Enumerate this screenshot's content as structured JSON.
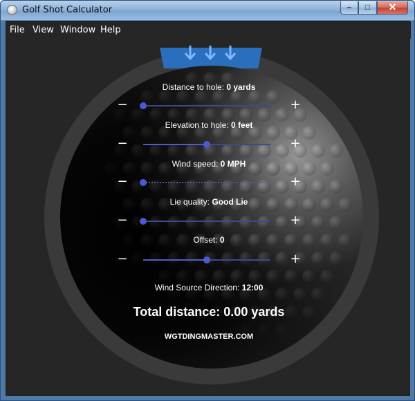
{
  "window": {
    "title": "Golf Shot Calculator",
    "controls": {
      "minimize": "–",
      "maximize": "□",
      "close": "✕"
    }
  },
  "menu": [
    "File",
    "View",
    "Window",
    "Help"
  ],
  "colors": {
    "accent": "#2a6fbd",
    "slider": "#4a5ad0",
    "background": "#262626",
    "ring": "#3a3a3a"
  },
  "icons": {
    "top_tab_arrows": [
      "arrow-down-icon",
      "arrow-down-icon",
      "arrow-down-icon"
    ],
    "decrement": "minus-icon",
    "increment": "plus-icon"
  },
  "controls": [
    {
      "label": "Distance to hole:",
      "value": "0 yards",
      "slider_fraction": 0.0,
      "minus": "−",
      "plus": "+"
    },
    {
      "label": "Elevation to hole:",
      "value": "0 feet",
      "slider_fraction": 0.5,
      "minus": "−",
      "plus": "+"
    },
    {
      "label": "Wind speed:",
      "value": "0 MPH",
      "slider_fraction": 0.0,
      "minus": "−",
      "plus": "+"
    },
    {
      "label": "Lie quality:",
      "value": "Good Lie",
      "slider_fraction": 0.0,
      "minus": "−",
      "plus": "+"
    },
    {
      "label": "Offset:",
      "value": "0",
      "slider_fraction": 0.5,
      "minus": "−",
      "plus": "+"
    }
  ],
  "wind_direction": {
    "label": "Wind Source Direction:",
    "value": "12:00"
  },
  "total": "Total distance: 0.00 yards",
  "brand": "WGTDINGMASTER.COM"
}
